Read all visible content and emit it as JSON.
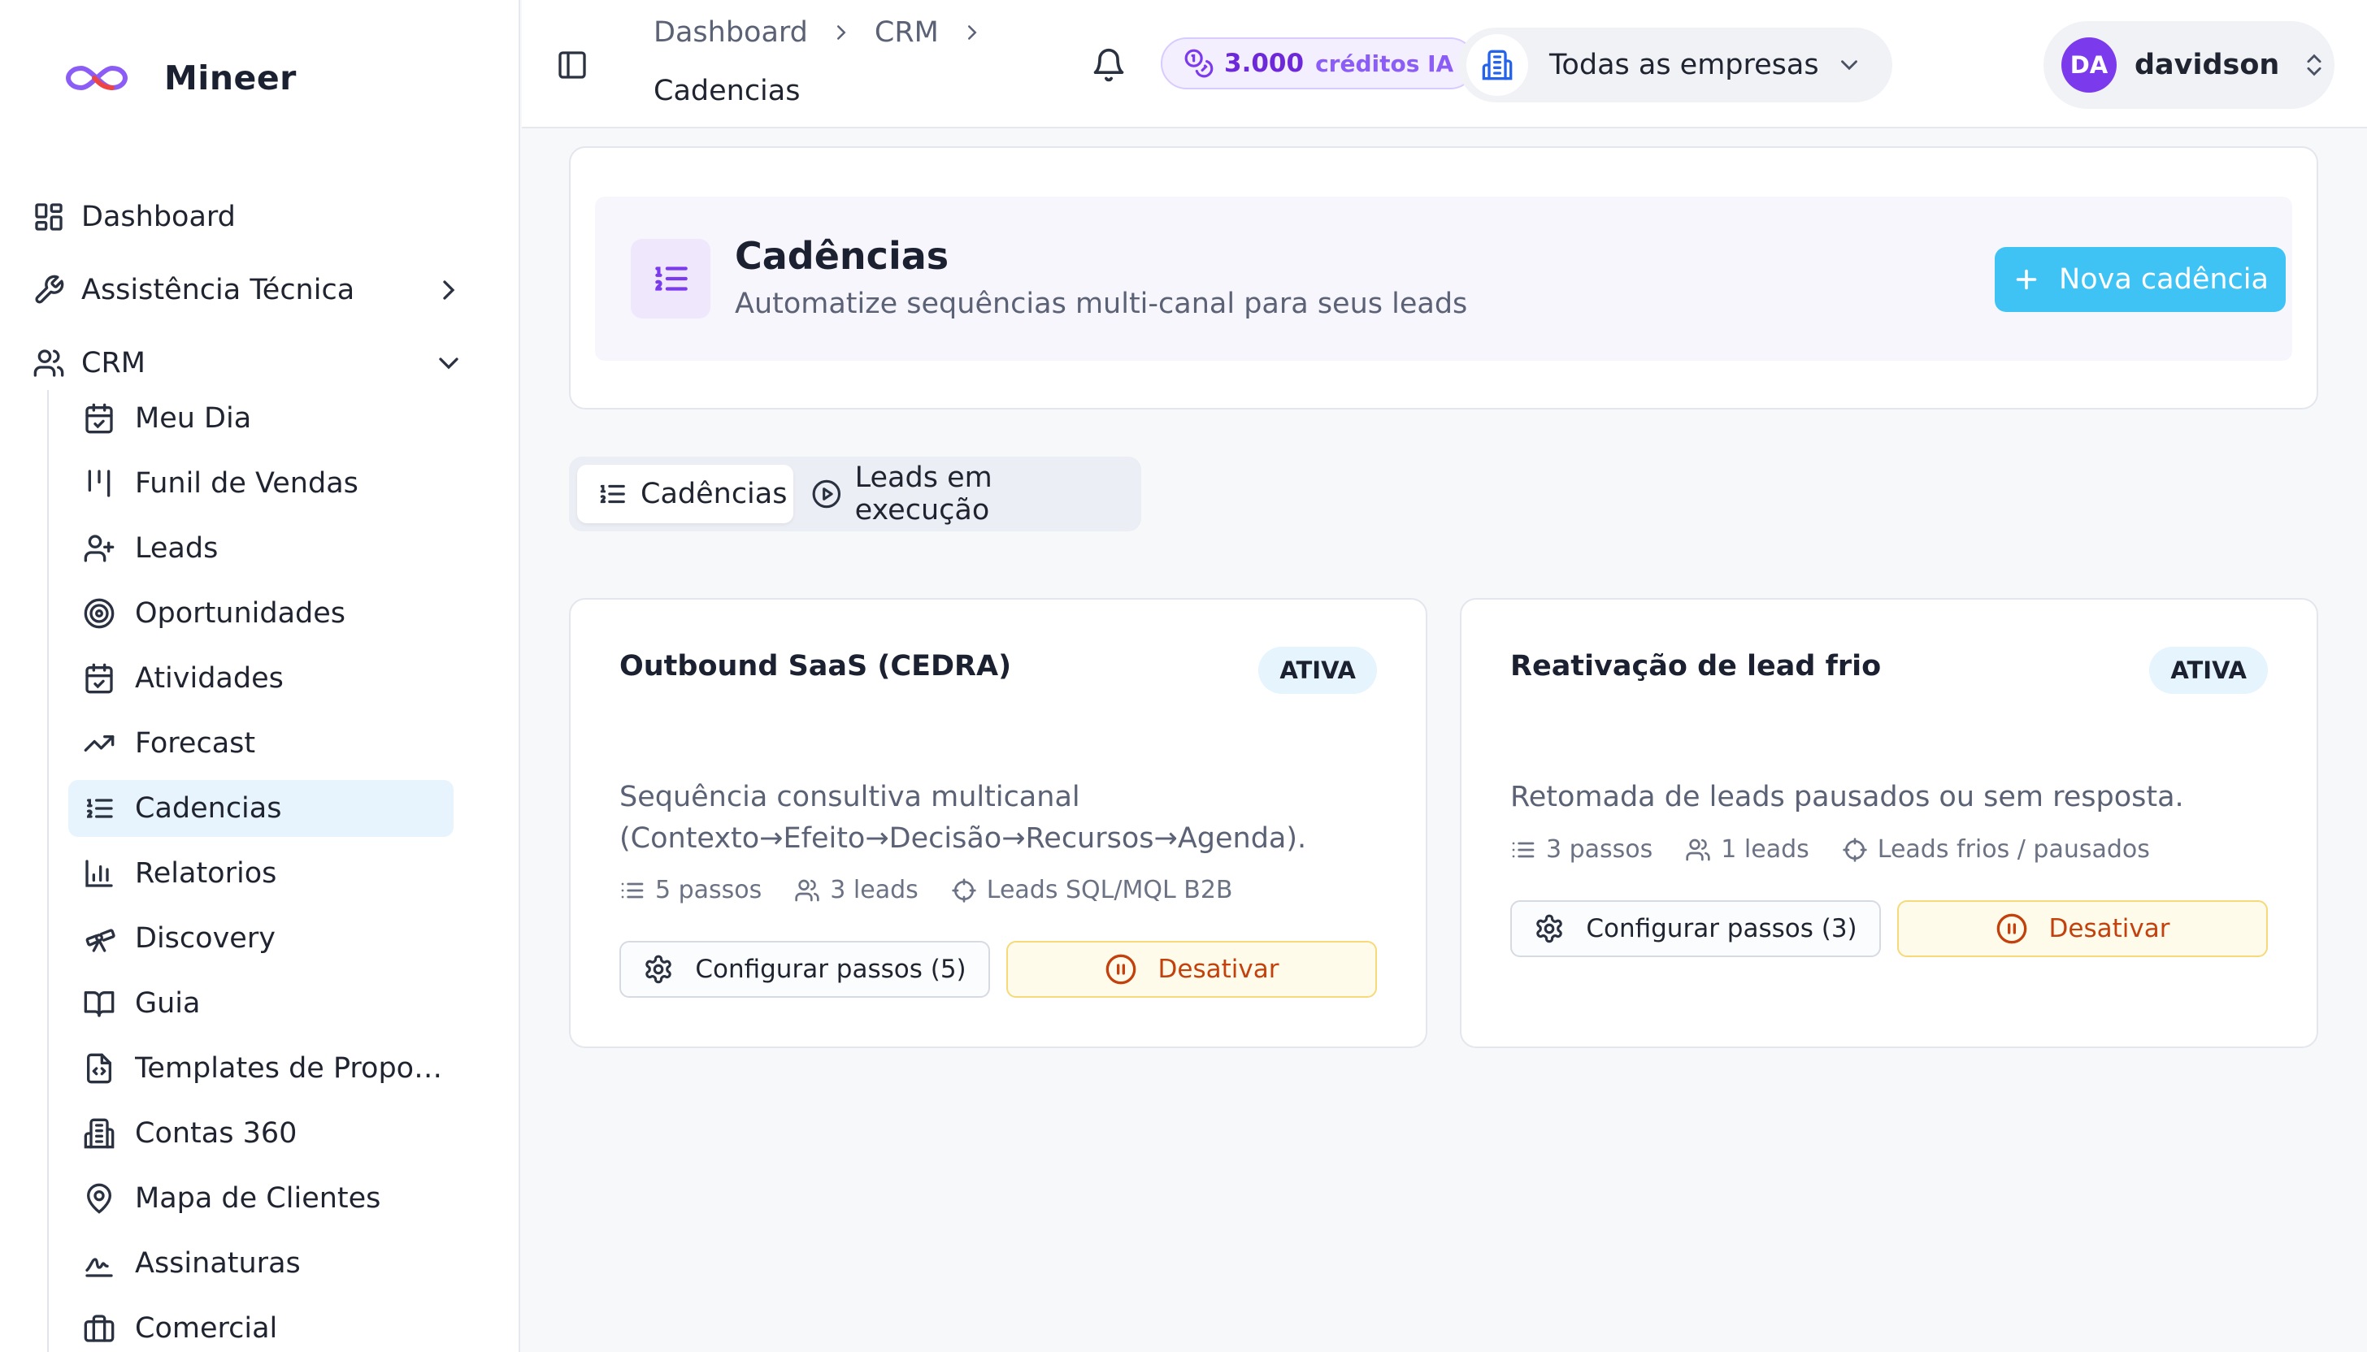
{
  "brand": {
    "name": "Mineer",
    "accent": "#7c3aed"
  },
  "sidebar": {
    "top_items": [
      {
        "label": "Dashboard",
        "icon": "dashboard-grid-icon"
      },
      {
        "label": "Assistência Técnica",
        "icon": "wrench-icon"
      },
      {
        "label": "CRM",
        "icon": "users-icon"
      }
    ],
    "crm_items": [
      {
        "label": "Meu Dia",
        "icon": "calendar-check-icon"
      },
      {
        "label": "Funil de Vendas",
        "icon": "kanban-icon"
      },
      {
        "label": "Leads",
        "icon": "user-plus-icon"
      },
      {
        "label": "Oportunidades",
        "icon": "target-icon"
      },
      {
        "label": "Atividades",
        "icon": "calendar-check-icon"
      },
      {
        "label": "Forecast",
        "icon": "trending-up-icon"
      },
      {
        "label": "Cadencias",
        "icon": "list-ordered-icon",
        "active": true
      },
      {
        "label": "Relatorios",
        "icon": "bar-chart-icon"
      },
      {
        "label": "Discovery",
        "icon": "telescope-icon"
      },
      {
        "label": "Guia",
        "icon": "book-icon"
      },
      {
        "label": "Templates de Propos...",
        "icon": "file-code-icon"
      },
      {
        "label": "Contas 360",
        "icon": "building-icon"
      },
      {
        "label": "Mapa de Clientes",
        "icon": "map-pin-icon"
      },
      {
        "label": "Assinaturas",
        "icon": "signature-icon"
      },
      {
        "label": "Comercial",
        "icon": "briefcase-icon"
      }
    ]
  },
  "header": {
    "breadcrumb": [
      "Dashboard",
      "CRM",
      "Cadencias"
    ],
    "credits": {
      "value": "3.000",
      "label": "créditos IA"
    },
    "company_selector": "Todas as empresas",
    "user": {
      "initials": "DA",
      "name": "davidson"
    }
  },
  "hero": {
    "title": "Cadências",
    "subtitle": "Automatize sequências multi-canal para seus leads",
    "new_button": "Nova cadência",
    "button_color": "#3fc3f5"
  },
  "tabs": [
    {
      "label": "Cadências",
      "active": true
    },
    {
      "label": "Leads em execução",
      "active": false
    }
  ],
  "cadences": [
    {
      "title": "Outbound SaaS (CEDRA)",
      "status": "ATIVA",
      "description": "Sequência consultiva multicanal (Contexto→Efeito→Decisão→Recursos→Agenda).",
      "steps": "5 passos",
      "leads": "3 leads",
      "target": "Leads SQL/MQL B2B",
      "config_button": "Configurar passos (5)",
      "deactivate_button": "Desativar"
    },
    {
      "title": "Reativação de lead frio",
      "status": "ATIVA",
      "description": "Retomada de leads pausados ou sem resposta.",
      "steps": "3 passos",
      "leads": "1 leads",
      "target": "Leads frios / pausados",
      "config_button": "Configurar passos (3)",
      "deactivate_button": "Desativar"
    }
  ]
}
